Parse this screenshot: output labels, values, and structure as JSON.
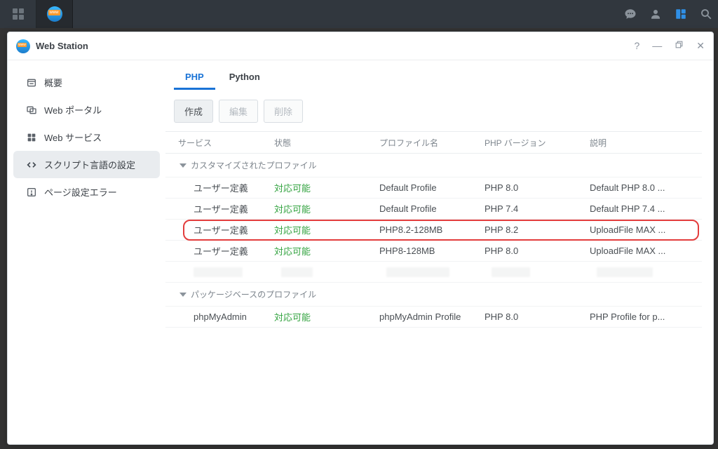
{
  "app_title": "Web Station",
  "sidebar": {
    "items": [
      {
        "label": "概要"
      },
      {
        "label": "Web ポータル"
      },
      {
        "label": "Web サービス"
      },
      {
        "label": "スクリプト言語の設定"
      },
      {
        "label": "ページ設定エラー"
      }
    ]
  },
  "tabs": {
    "php": "PHP",
    "python": "Python"
  },
  "toolbar": {
    "create": "作成",
    "edit": "編集",
    "delete": "削除"
  },
  "columns": {
    "service": "サービス",
    "state": "状態",
    "profile": "プロファイル名",
    "version": "PHP バージョン",
    "desc": "説明"
  },
  "groups": {
    "custom": "カスタマイズされたプロファイル",
    "package": "パッケージベースのプロファイル"
  },
  "rows_custom": [
    {
      "service": "ユーザー定義",
      "state": "対応可能",
      "profile": "Default Profile",
      "version": "PHP 8.0",
      "desc": "Default PHP 8.0 ..."
    },
    {
      "service": "ユーザー定義",
      "state": "対応可能",
      "profile": "Default Profile",
      "version": "PHP 7.4",
      "desc": "Default PHP 7.4 ..."
    },
    {
      "service": "ユーザー定義",
      "state": "対応可能",
      "profile": "PHP8.2-128MB",
      "version": "PHP 8.2",
      "desc": "UploadFile MAX ..."
    },
    {
      "service": "ユーザー定義",
      "state": "対応可能",
      "profile": "PHP8-128MB",
      "version": "PHP 8.0",
      "desc": "UploadFile MAX ..."
    }
  ],
  "rows_package": [
    {
      "service": "phpMyAdmin",
      "state": "対応可能",
      "profile": "phpMyAdmin Profile",
      "version": "PHP 8.0",
      "desc": "PHP Profile for p..."
    }
  ],
  "highlight_index": 2
}
